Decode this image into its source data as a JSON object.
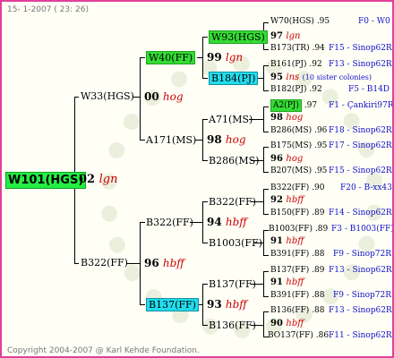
{
  "header": "15- 1-2007 ( 23: 26)",
  "footer": "Copyright 2004-2007 @ Karl Kehde Foundation.",
  "gen1": {
    "name": "W101(HGS)",
    "year": "02",
    "breeder": "lgn"
  },
  "gen2": [
    {
      "name": "W33(HGS)",
      "year": "00",
      "breeder": "hog"
    },
    {
      "name": "B322(FF)",
      "year": "96",
      "breeder": "hbff"
    }
  ],
  "gen3": [
    {
      "name": "W40(FF)",
      "year": "99",
      "breeder": "lgn"
    },
    {
      "name": "A171(MS)",
      "year": "98",
      "breeder": "hog"
    },
    {
      "name": "B322(FF)",
      "year": "94",
      "breeder": "hbff"
    },
    {
      "name": "B137(FF)",
      "year": "93",
      "breeder": "hbff"
    }
  ],
  "gen4": [
    {
      "name": "W93(HGS)",
      "year": "97",
      "breeder": "lgn"
    },
    {
      "name": "B184(PJ)",
      "year": "95",
      "breeder": "ins"
    },
    {
      "name": "A71(MS)",
      "year": "98",
      "breeder": "hog"
    },
    {
      "name": "B286(MS)",
      "year": "96",
      "breeder": "hog"
    },
    {
      "name": "B322(FF)",
      "year": "92",
      "breeder": "hbff"
    },
    {
      "name": "B1003(FF)",
      "year": "91",
      "breeder": "hbff"
    },
    {
      "name": "B137(FF)",
      "year": "91",
      "breeder": "hbff"
    },
    {
      "name": "B136(FF)",
      "year": "90",
      "breeder": "hbff"
    }
  ],
  "gen5": [
    {
      "name": "W70(HGS)",
      "val": ".95",
      "line": "F0 - W0"
    },
    {
      "name": "B173(TR)",
      "val": ".94",
      "line": "F15 - Sinop62R"
    },
    {
      "name": "B161(PJ)",
      "val": ".92",
      "line": "F13 - Sinop62R"
    },
    {
      "name": "B182(PJ)",
      "val": ".92",
      "line": "F5 - B14D"
    },
    {
      "name": "A2(PJ)",
      "val": ".97",
      "line": "F1 - Çankiri97R"
    },
    {
      "name": "B286(MS)",
      "val": ".96",
      "line": "F18 - Sinop62R"
    },
    {
      "name": "B175(MS)",
      "val": ".95",
      "line": "F17 - Sinop62R"
    },
    {
      "name": "B207(MS)",
      "val": ".95",
      "line": "F15 - Sinop62R"
    },
    {
      "name": "B322(FF)",
      "val": ".90",
      "line": "F20 - B-xx43"
    },
    {
      "name": "B150(FF)",
      "val": ".89",
      "line": "F14 - Sinop62R"
    },
    {
      "name": "B1003(FF)",
      "val": ".89",
      "line": "F3 - B1003(FF)"
    },
    {
      "name": "B391(FF)",
      "val": ".88",
      "line": "F9 - Sinop72R"
    },
    {
      "name": "B137(FF)",
      "val": ".89",
      "line": "F13 - Sinop62R"
    },
    {
      "name": "B391(FF)",
      "val": ".88",
      "line": "F9 - Sinop72R"
    },
    {
      "name": "B136(FF)",
      "val": ".88",
      "line": "F13 - Sinop62R"
    },
    {
      "name": "BO137(FF)",
      "val": ".86",
      "line": "F11 - Sinop62R"
    }
  ],
  "gen5_years": [
    {
      "year": "97",
      "breeder": "lgn"
    },
    {
      "year": "95",
      "breeder": "ins",
      "note": "(10 sister colonies)"
    },
    {
      "year": "98",
      "breeder": "hog"
    },
    {
      "year": "96",
      "breeder": "hog"
    },
    {
      "year": "92",
      "breeder": "hbff"
    },
    {
      "year": "91",
      "breeder": "hbff"
    },
    {
      "year": "91",
      "breeder": "hbff"
    },
    {
      "year": "90",
      "breeder": "hbff"
    }
  ]
}
